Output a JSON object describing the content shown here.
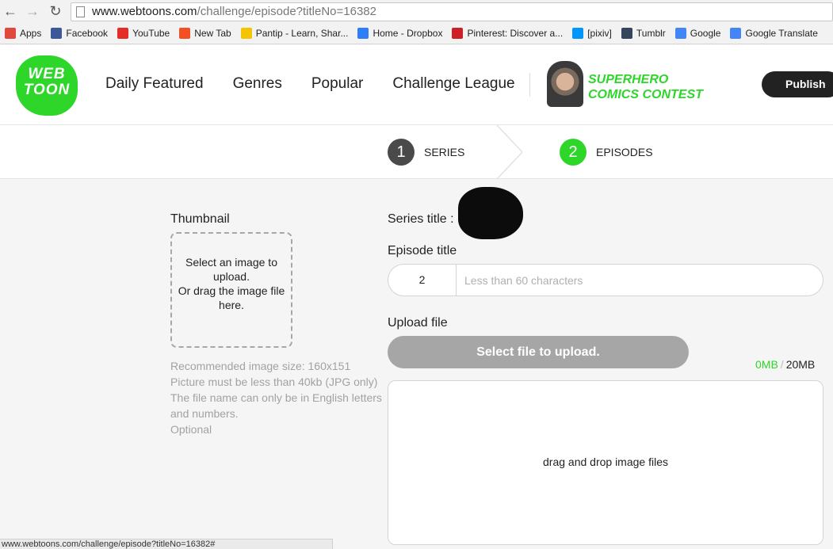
{
  "browser": {
    "url_host": "www.webtoons.com",
    "url_path": "/challenge/episode?titleNo=16382",
    "bookmarks": [
      {
        "label": "Apps",
        "icon": "apps-grid-icon",
        "color": "#e0493b"
      },
      {
        "label": "Facebook",
        "icon": "facebook-icon",
        "color": "#3b5998"
      },
      {
        "label": "YouTube",
        "icon": "youtube-icon",
        "color": "#e52d27"
      },
      {
        "label": "New Tab",
        "icon": "windows-icon",
        "color": "#f25022"
      },
      {
        "label": "Pantip - Learn, Shar...",
        "icon": "pantip-icon",
        "color": "#f5c400"
      },
      {
        "label": "Home - Dropbox",
        "icon": "dropbox-icon",
        "color": "#2d7ff9"
      },
      {
        "label": "Pinterest: Discover a...",
        "icon": "pinterest-icon",
        "color": "#cb2027"
      },
      {
        "label": "[pixiv]",
        "icon": "pixiv-icon",
        "color": "#0096fa"
      },
      {
        "label": "Tumblr",
        "icon": "tumblr-icon",
        "color": "#35465c"
      },
      {
        "label": "Google",
        "icon": "google-icon",
        "color": "#4285f4"
      },
      {
        "label": "Google Translate",
        "icon": "google-translate-icon",
        "color": "#4285f4"
      }
    ],
    "status_url": "www.webtoons.com/challenge/episode?titleNo=16382#"
  },
  "header": {
    "logo_line1": "WEB",
    "logo_line2": "TOON",
    "nav": [
      "Daily Featured",
      "Genres",
      "Popular",
      "Challenge League"
    ],
    "contest_line1": "SUPERHERO",
    "contest_line2": "COMICS CONTEST",
    "publish_label": "Publish"
  },
  "steps": [
    {
      "number": "1",
      "label": "SERIES",
      "color": "#4a4a4a"
    },
    {
      "number": "2",
      "label": "EPISODES",
      "color": "#2ed62a"
    }
  ],
  "form": {
    "thumbnail_label": "Thumbnail",
    "thumb_prompt_1": "Select an image to upload.",
    "thumb_prompt_2": "Or drag the image file here.",
    "thumb_help": [
      "Recommended image size: 160x151",
      "Picture must be less than 40kb (JPG only)",
      "The file name can only be in English letters and numbers.",
      "Optional"
    ],
    "series_title_label": "Series title :",
    "episode_title_label": "Episode title",
    "episode_number": "2",
    "episode_title_value": "",
    "episode_title_placeholder": "Less than 60 characters",
    "upload_file_label": "Upload file",
    "upload_button_label": "Select file to upload.",
    "size_used": "0MB",
    "size_sep": "/",
    "size_max": "20MB",
    "drop_zone_text": "drag and drop image files"
  },
  "colors": {
    "brand_green": "#2ed62a",
    "publish_bg": "#222222",
    "upload_btn_bg": "#a6a6a6"
  }
}
